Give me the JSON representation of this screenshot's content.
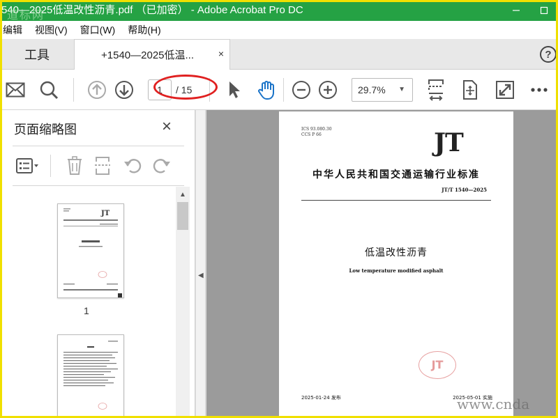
{
  "window": {
    "title": "540—2025低温改性沥青.pdf （已加密） - Adobe Acrobat Pro DC",
    "watermark_top": "道标网",
    "watermark_bottom": "www.cnda"
  },
  "menu": {
    "items": [
      "编辑",
      "视图(V)",
      "窗口(W)",
      "帮助(H)"
    ]
  },
  "tabs": {
    "tools": "工具",
    "document": "+1540—2025低温...",
    "close_glyph": "×",
    "help": "?"
  },
  "toolbar": {
    "current_page": "1",
    "page_total": "/ 15",
    "zoom": "29.7%"
  },
  "left_panel": {
    "title": "页面缩略图",
    "close_glyph": "×",
    "thumbnails": [
      {
        "number": "1"
      }
    ]
  },
  "document_page": {
    "ics": "ICS 93.080.30",
    "ccs": "CCS P 66",
    "logo": "JT",
    "standard_title": "中华人民共和国交通运输行业标准",
    "standard_code": "JT/T  1540—2025",
    "title_cn": "低温改性沥青",
    "title_en": "Low temperature modified asphalt",
    "stamp": "JT",
    "issue_date": "2025-01-24 发布",
    "implement_date": "2025-05-01 实施"
  },
  "colors": {
    "titlebar": "#25a244",
    "frame": "#f0e000",
    "annotation": "#e02020",
    "hand_tool": "#1a73c8"
  },
  "icons": [
    "mail-icon",
    "search-icon",
    "page-up-icon",
    "page-down-icon",
    "select-pointer-icon",
    "hand-tool-icon",
    "zoom-out-icon",
    "zoom-in-icon",
    "fit-page-icon",
    "rotate-view-icon",
    "fullscreen-icon",
    "more-icon"
  ]
}
